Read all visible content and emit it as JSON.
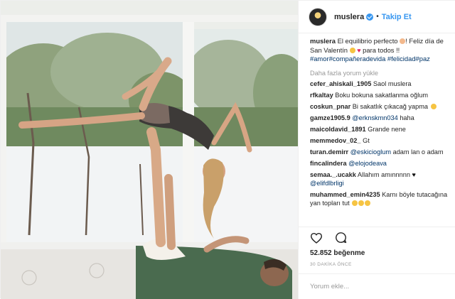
{
  "header": {
    "username": "muslera",
    "separator": "•",
    "follow_label": "Takip Et"
  },
  "caption": {
    "username": "muslera",
    "text_1": "El equilibrio perfecto",
    "text_2": "! Feliz día de San Valentín",
    "text_3": "para todos !!",
    "hashtags": "#amor#compañeradevida #felicidad#paz"
  },
  "load_more_label": "Daha fazla yorum yükle",
  "comments": [
    {
      "user": "cefer_ahiskali_1905",
      "text": "Saol muslera"
    },
    {
      "user": "rfkaltay",
      "text": "Boku bokuna sakatlanma oğlum"
    },
    {
      "user": "coskun_pnar",
      "text": "Bi sakatlık çıkacağ yapma"
    },
    {
      "user": "gamze1905.9",
      "mention": "@erknskmn034",
      "text": "haha"
    },
    {
      "user": "maicoldavid_1891",
      "text": "Grande nene"
    },
    {
      "user": "memmedov_02_",
      "text": "Gt"
    },
    {
      "user": "turan.demirr",
      "mention": "@eskicioglum",
      "text": "adam lan o adam"
    },
    {
      "user": "fincalindera",
      "mention": "@elojodeava",
      "text": ""
    },
    {
      "user": "semaa._.ucakk",
      "text": "Allahım amınnnnn",
      "mention2": "@elifdlbrligi"
    },
    {
      "user": "muhammed_emin4235",
      "text": "Karnı böyle tutacağına yan topları tut"
    }
  ],
  "likes": "52.852 beğenme",
  "timestamp": "30 DAKİKA ÖNCE",
  "add_comment": {
    "placeholder": "Yorum ekle..."
  },
  "icons": [
    "heart-icon",
    "comment-icon",
    "verified-badge-icon"
  ],
  "colors": {
    "accent": "#3897f0",
    "hashtag": "#003569",
    "muted": "#999999"
  }
}
